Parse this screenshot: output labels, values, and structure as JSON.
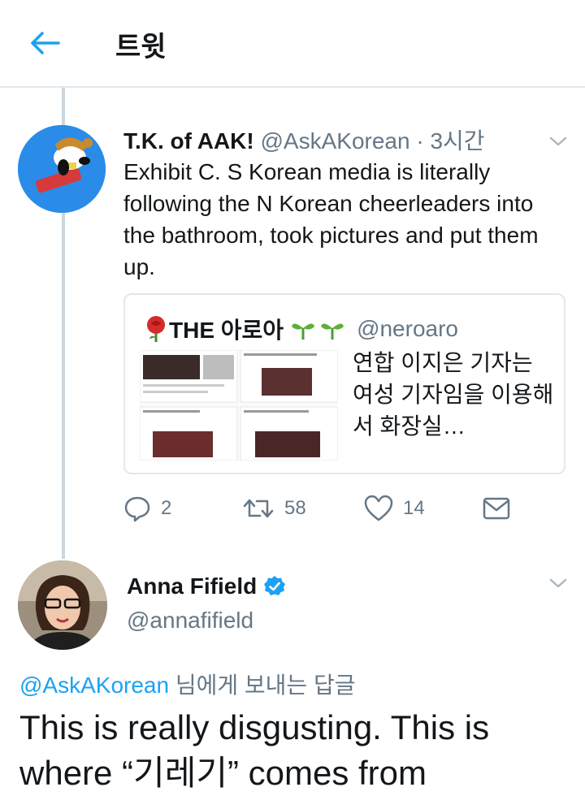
{
  "header": {
    "title": "트윗"
  },
  "tweet1": {
    "name": "T.K. of AAK!",
    "handle": "@AskAKorean",
    "time": "· 3시간",
    "text": "Exhibit C. S Korean media is literally following the N Korean cheerleaders into the bathroom, took pictures and put them up.",
    "quote": {
      "name": "THE 아로아",
      "handle": "@neroaro",
      "text": "연합 이지은 기자는 여성 기자임을 이용해서 화장실…"
    },
    "actions": {
      "replies": "2",
      "retweets": "58",
      "likes": "14"
    }
  },
  "tweet2": {
    "name": "Anna Fifield",
    "handle": "@annafifield",
    "reply_mention": "@AskAKorean",
    "reply_suffix": " 님에게 보내는 답글",
    "text": "This is really disgusting. This is where “기레기” comes from"
  },
  "colors": {
    "accent": "#1da1f2",
    "secondary_text": "#657786",
    "border": "#e1e8ed"
  }
}
